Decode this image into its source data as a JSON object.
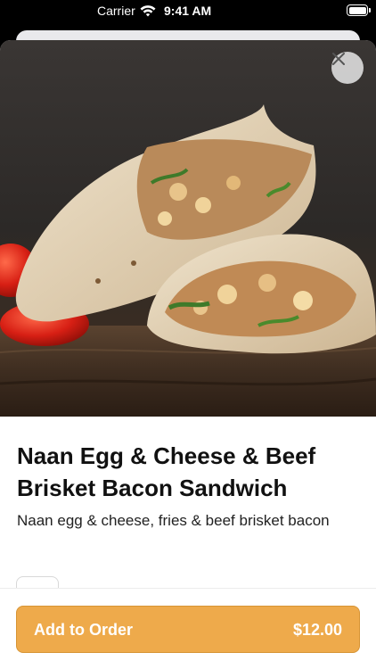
{
  "status_bar": {
    "carrier": "Carrier",
    "time": "9:41 AM"
  },
  "item": {
    "title": "Naan Egg & Cheese & Beef Brisket Bacon Sandwich",
    "description": "Naan egg & cheese, fries & beef brisket bacon",
    "image_icon": "food-photo"
  },
  "actions": {
    "close_icon": "close-icon",
    "add_label": "Add to Order",
    "price": "$12.00"
  },
  "colors": {
    "accent": "#eeaa4b",
    "accent_border": "#d79434"
  }
}
